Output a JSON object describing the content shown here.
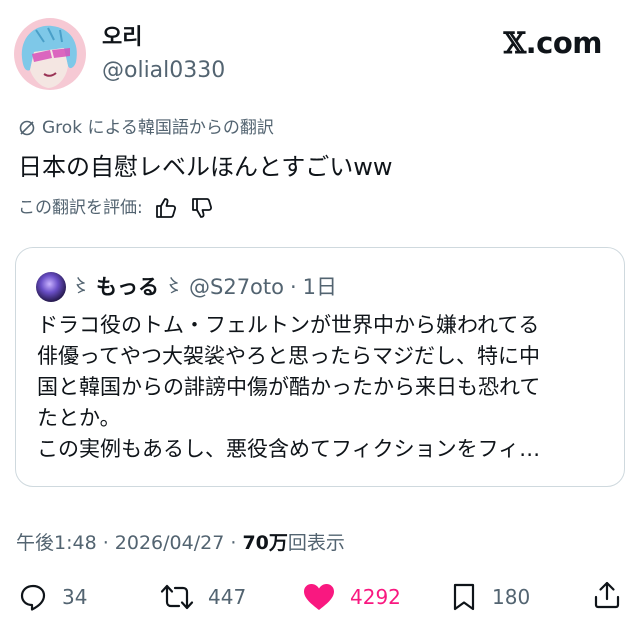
{
  "author": {
    "display_name": "오리",
    "handle": "@olial0330"
  },
  "brand": {
    "x_glyph": "𝕏",
    "suffix": ".com"
  },
  "translation_note": "Grok による韓国語からの翻訳",
  "tweet_text": "日本の自慰レベルほんとすごいww",
  "rate_translation_label": "この翻訳を評価:",
  "quote": {
    "deco_left": "〻",
    "display_name": "もっる",
    "deco_right": "〻",
    "handle": "@S27oto",
    "separator": "·",
    "time": "1日",
    "lines": [
      "ドラコ役のトム・フェルトンが世界中から嫌われてる",
      "俳優ってやつ大袈裟やろと思ったらマジだし、特に中",
      "国と韓国からの誹謗中傷が酷かったから来日も恐れて",
      "たとか。",
      "この実例もあるし、悪役含めてフィクションをフィ…"
    ]
  },
  "meta": {
    "time": "午後1:48",
    "sep1": " · ",
    "date": "2026/04/27",
    "sep2": " · ",
    "views_count": "70万",
    "views_label": "回表示"
  },
  "actions": {
    "replies": "34",
    "reposts": "447",
    "likes": "4292",
    "bookmarks": "180"
  },
  "colors": {
    "text": "#0f1419",
    "secondary": "#536471",
    "like": "#f91880",
    "border": "#cfd9de"
  }
}
